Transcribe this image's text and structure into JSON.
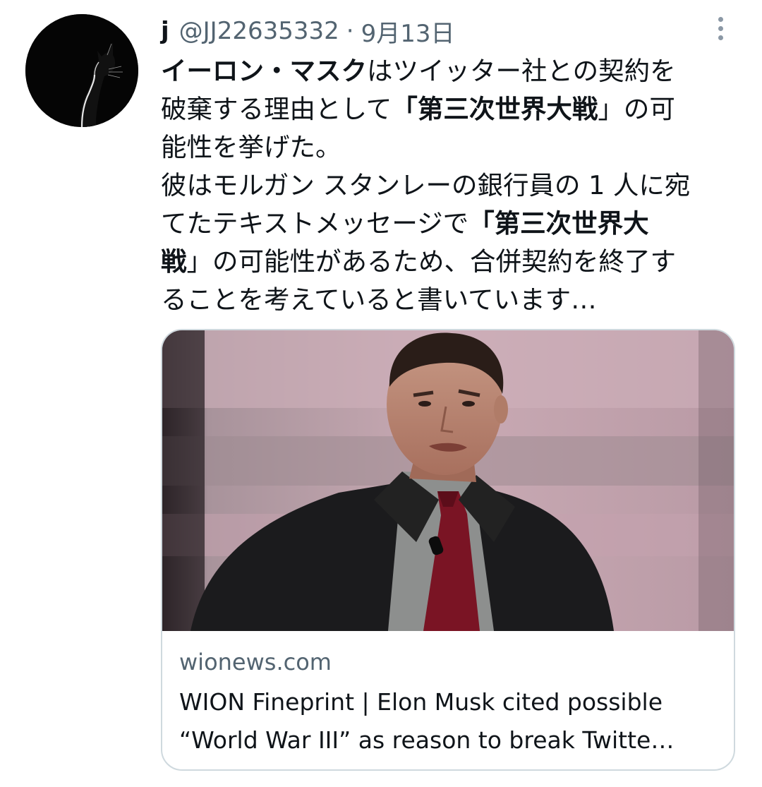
{
  "tweet": {
    "author": {
      "display_name": "j",
      "handle": "@JJ22635332",
      "avatar_icon": "cat-silhouette-avatar"
    },
    "separator": "·",
    "date": "9月13日",
    "more_icon": "more-vertical-icon",
    "text_lines": [
      [
        {
          "t": "イーロン・マスク",
          "bold": true
        },
        {
          "t": "はツイッター社との契約を",
          "bold": false
        }
      ],
      [
        {
          "t": "破棄する理由として",
          "bold": false
        },
        {
          "t": "「第三次世界大戦",
          "bold": true
        },
        {
          "t": "」の可",
          "bold": false
        }
      ],
      [
        {
          "t": "能性を挙げた。",
          "bold": false
        }
      ],
      [
        {
          "t": "彼はモルガン スタンレーの銀行員の 1 人に宛",
          "bold": false
        }
      ],
      [
        {
          "t": "てたテキストメッセージで",
          "bold": false
        },
        {
          "t": "「第三次世界大",
          "bold": true
        }
      ],
      [
        {
          "t": "戦",
          "bold": true
        },
        {
          "t": "」の可能性があるため、合併契約を終了す",
          "bold": false
        }
      ],
      [
        {
          "t": "ることを考えていると書いています…",
          "bold": false
        }
      ]
    ]
  },
  "card": {
    "domain": "wionews.com",
    "title_lines": [
      "WION Fineprint | Elon Musk cited possible",
      "“World War III” as reason to break Twitte…"
    ],
    "image_icon": "man-in-suit-photo"
  }
}
